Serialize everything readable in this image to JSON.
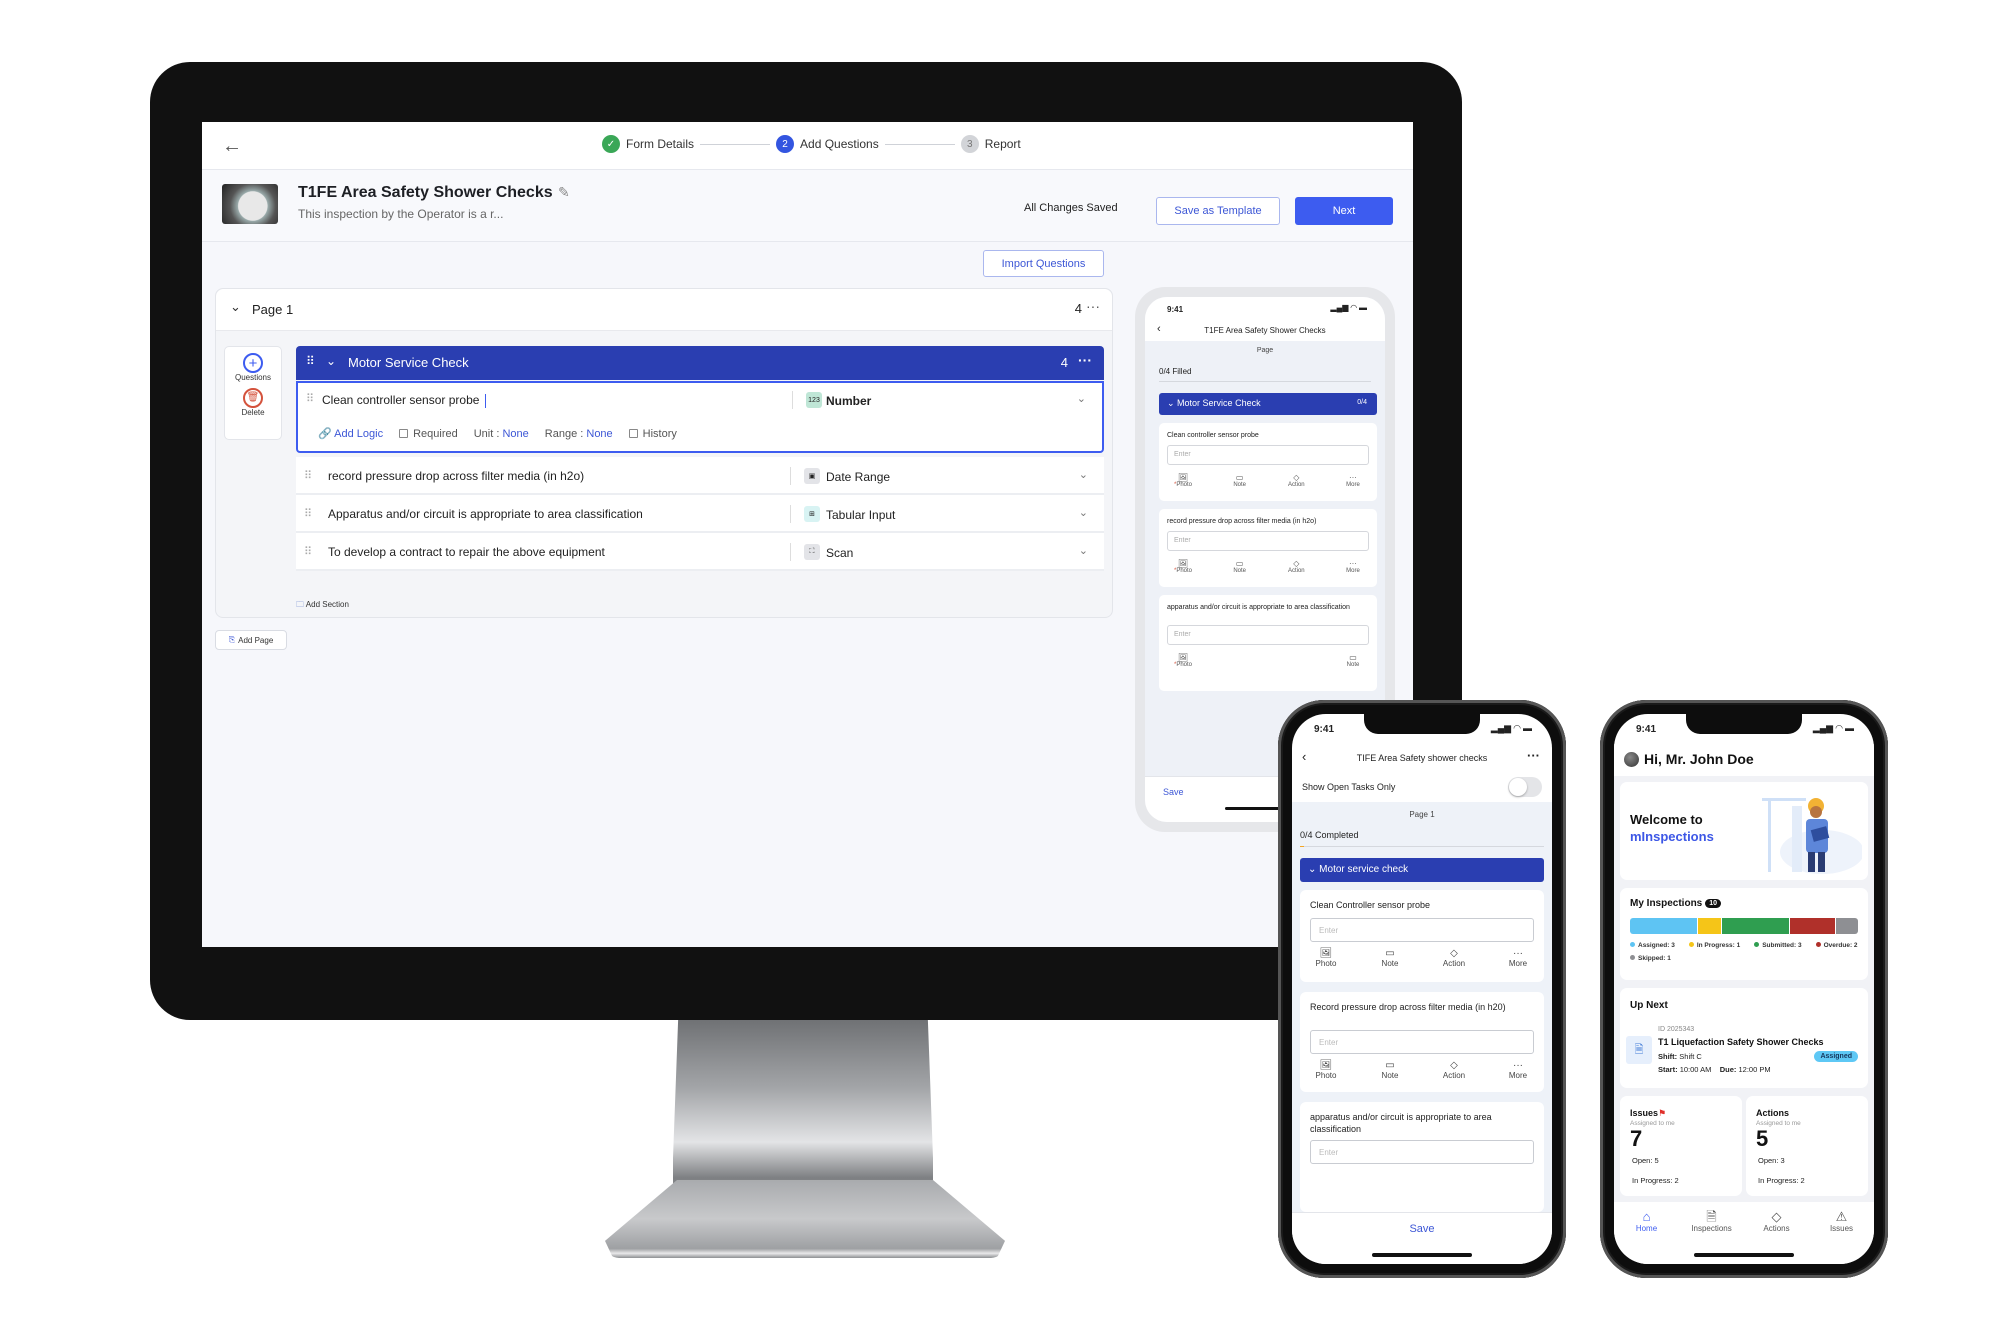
{
  "desktop": {
    "stepper": {
      "steps": [
        {
          "label": "Form Details",
          "state": "done",
          "num": "✓"
        },
        {
          "label": "Add Questions",
          "state": "active",
          "num": "2"
        },
        {
          "label": "Report",
          "state": "todo",
          "num": "3"
        }
      ]
    },
    "form": {
      "title": "T1FE Area Safety Shower Checks",
      "subtitle": "This inspection by the Operator is a r...",
      "save_status": "All Changes Saved",
      "save_template_label": "Save as Template",
      "next_label": "Next",
      "import_label": "Import Questions"
    },
    "page": {
      "title": "Page 1",
      "count": "4",
      "tools": {
        "questions_label": "Questions",
        "delete_label": "Delete"
      },
      "section": {
        "title": "Motor Service Check",
        "count": "4"
      },
      "questions": [
        {
          "text": "Clean controller sensor probe",
          "type": "Number",
          "icon": "123",
          "icon_bg": "#bfe6d6"
        },
        {
          "text": "record pressure drop across filter media (in h2o)",
          "type": "Date Range",
          "icon": "▣",
          "icon_bg": "#e3e4e8"
        },
        {
          "text": "Apparatus and/or circuit is appropriate to area classification",
          "type": "Tabular Input",
          "icon": "⊞",
          "icon_bg": "#d8f3f3"
        },
        {
          "text": "To develop a contract to repair the above equipment",
          "type": "Scan",
          "icon": "⛶",
          "icon_bg": "#e3e4e8"
        }
      ],
      "active_options": {
        "add_logic": "Add Logic",
        "required": "Required",
        "unit_label": "Unit :",
        "unit_value": "None",
        "range_label": "Range :",
        "range_value": "None",
        "history": "History"
      },
      "add_section_label": "Add Section",
      "add_page_label": "Add Page"
    },
    "preview": {
      "time": "9:41",
      "title": "T1FE Area Safety Shower Checks",
      "page_label": "Page",
      "filled": "0/4 Filled",
      "section_title": "Motor Service Check",
      "section_count": "0/4",
      "placeholder": "Enter",
      "questions": [
        "Clean controller sensor probe",
        "record pressure drop across filter media (in h2o)",
        "apparatus and/or circuit is appropriate to area classification"
      ],
      "actions": [
        "Photo",
        "Note",
        "Action",
        "More"
      ],
      "save_label": "Save"
    }
  },
  "phone_form": {
    "time": "9:41",
    "title": "TIFE Area Safety shower checks",
    "toggle_label": "Show Open Tasks Only",
    "toggle_on": false,
    "page_label": "Page 1",
    "completed": "0/4 Completed",
    "section_title": "Motor service check",
    "placeholder": "Enter",
    "questions": [
      "Clean Controller sensor probe",
      "Record pressure drop across filter media (in h20)",
      "apparatus and/or circuit is appropriate to area classification"
    ],
    "actions": [
      "Photo",
      "Note",
      "Action",
      "More"
    ],
    "save_label": "Save"
  },
  "phone_home": {
    "time": "9:41",
    "greeting": "Hi, Mr. John Doe",
    "welcome_line1": "Welcome to",
    "welcome_line2": "mInspections",
    "inspections_title": "My Inspections",
    "inspections_total": "10",
    "status_breakdown": [
      {
        "label": "Assigned: 3",
        "count": 3,
        "color": "#5ec4f3"
      },
      {
        "label": "In Progress: 1",
        "count": 1,
        "color": "#f5c518"
      },
      {
        "label": "Submitted: 3",
        "count": 3,
        "color": "#2f9e50"
      },
      {
        "label": "Overdue: 2",
        "count": 2,
        "color": "#b0302a"
      },
      {
        "label": "Skipped: 1",
        "count": 1,
        "color": "#8e8f93"
      }
    ],
    "up_next": {
      "title": "Up Next",
      "id": "ID 2025343",
      "name": "T1 Liquefaction Safety Shower Checks",
      "shift_label": "Shift:",
      "shift_value": "Shift C",
      "start_label": "Start:",
      "start_value": "10:00 AM",
      "due_label": "Due:",
      "due_value": "12:00 PM",
      "status": "Assigned"
    },
    "issues": {
      "title": "Issues",
      "sub": "Assigned to me",
      "count": "7",
      "open": "Open: 5",
      "in_progress": "In Progress: 2"
    },
    "actions": {
      "title": "Actions",
      "sub": "Assigned to me",
      "count": "5",
      "open": "Open: 3",
      "in_progress": "In Progress: 2"
    },
    "tabs": [
      {
        "label": "Home",
        "icon": "⌂",
        "active": true
      },
      {
        "label": "Inspections",
        "icon": "🗎",
        "active": false
      },
      {
        "label": "Actions",
        "icon": "◇",
        "active": false
      },
      {
        "label": "Issues",
        "icon": "⚠",
        "active": false
      }
    ]
  }
}
